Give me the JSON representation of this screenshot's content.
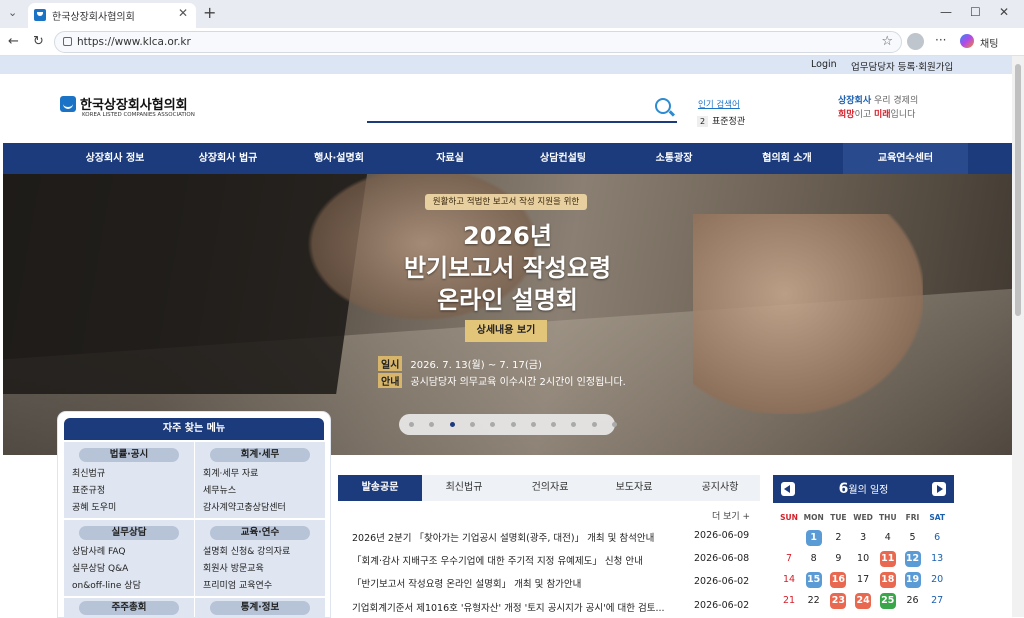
{
  "browser": {
    "tab_title": "한국상장회사협의회",
    "url": "https://www.klca.or.kr",
    "chat_label": "채팅"
  },
  "util": {
    "login": "Login",
    "register": "업무담당자 등록·회원가입"
  },
  "header": {
    "logo_name": "한국상장회사협의회",
    "logo_en": "KOREA LISTED COMPANIES ASSOCIATION",
    "popular_label": "인기 검색어",
    "rank_no": "2",
    "rank_word": "표준정관",
    "slogan": {
      "p1": "상장회사",
      "p2": " 우리 경제의",
      "p3": "희망",
      "p4": "이고 ",
      "p5": "미래",
      "p6": "입니다"
    }
  },
  "gnb": [
    "상장회사 정보",
    "상장회사 법규",
    "행사·설명회",
    "자료실",
    "상담컨설팅",
    "소통광장",
    "협의회 소개",
    "교육연수센터"
  ],
  "hero": {
    "badge": "원활하고 적법한 보고서 작성 지원을 위한",
    "line1": "2026년",
    "line2": "반기보고서 작성요령",
    "line3": "온라인 설명회",
    "button": "상세내용 보기",
    "info": [
      {
        "k": "일시",
        "v": "2026. 7. 13(월) ~ 7. 17(금)"
      },
      {
        "k": "안내",
        "v": "공시담당자 의무교육 이수시간 2시간이 인정됩니다."
      }
    ],
    "active_slide": 3
  },
  "quick": {
    "title": "자주 찾는 메뉴",
    "groups": [
      {
        "h": "법률·공시",
        "items": [
          "최신법규",
          "표준규정",
          "공혜 도우미"
        ]
      },
      {
        "h": "회계·세무",
        "items": [
          "회계·세무 자료",
          "세무뉴스",
          "감사계약고충상담센터"
        ]
      },
      {
        "h": "실무상담",
        "items": [
          "상담사례 FAQ",
          "실무상담 Q&A",
          "on&off-line 상담"
        ]
      },
      {
        "h": "교육·연수",
        "items": [
          "설명회 신청& 강의자료",
          "회원사 방문교육",
          "프리미엄 교육연수"
        ]
      },
      {
        "h": "주주총회",
        "items": []
      },
      {
        "h": "통계·정보",
        "items": []
      }
    ]
  },
  "notices": {
    "tabs": [
      "발송공문",
      "최신법규",
      "건의자료",
      "보도자료",
      "공지사항"
    ],
    "more": "더 보기 +",
    "rows": [
      {
        "t": "2026년 2분기 「찾아가는 기업공시 설명회(광주, 대전)」 개최 및 참석안내",
        "d": "2026-06-09"
      },
      {
        "t": "「회계·감사 지배구조 우수기업에 대한 주기적 지정 유예제도」 신청 안내",
        "d": "2026-06-08"
      },
      {
        "t": "「반기보고서 작성요령 온라인 설명회」 개최 및 참가안내",
        "d": "2026-06-02"
      },
      {
        "t": "기업회계기준서 제1016호 '유형자산' 개정 '토지 공시지가 공시'에 대한 검토...",
        "d": "2026-06-02"
      }
    ]
  },
  "calendar": {
    "month": "6",
    "suffix": "월의 일정",
    "dow": [
      "SUN",
      "MON",
      "TUE",
      "WED",
      "THU",
      "FRI",
      "SAT"
    ],
    "weeks": [
      [
        "",
        "1",
        "2",
        "3",
        "4",
        "5",
        "6"
      ],
      [
        "7",
        "8",
        "9",
        "10",
        "11",
        "12",
        "13"
      ],
      [
        "14",
        "15",
        "16",
        "17",
        "18",
        "19",
        "20"
      ],
      [
        "21",
        "22",
        "23",
        "24",
        "25",
        "26",
        "27"
      ]
    ],
    "marked": {
      "1": "#5b9bd5",
      "11": "#e8694f",
      "12": "#5b9bd5",
      "15": "#5b9bd5",
      "16": "#e8694f",
      "18": "#e8694f",
      "19": "#5b9bd5",
      "23": "#e8694f",
      "24": "#e8694f",
      "25": "#3aa64a"
    }
  }
}
